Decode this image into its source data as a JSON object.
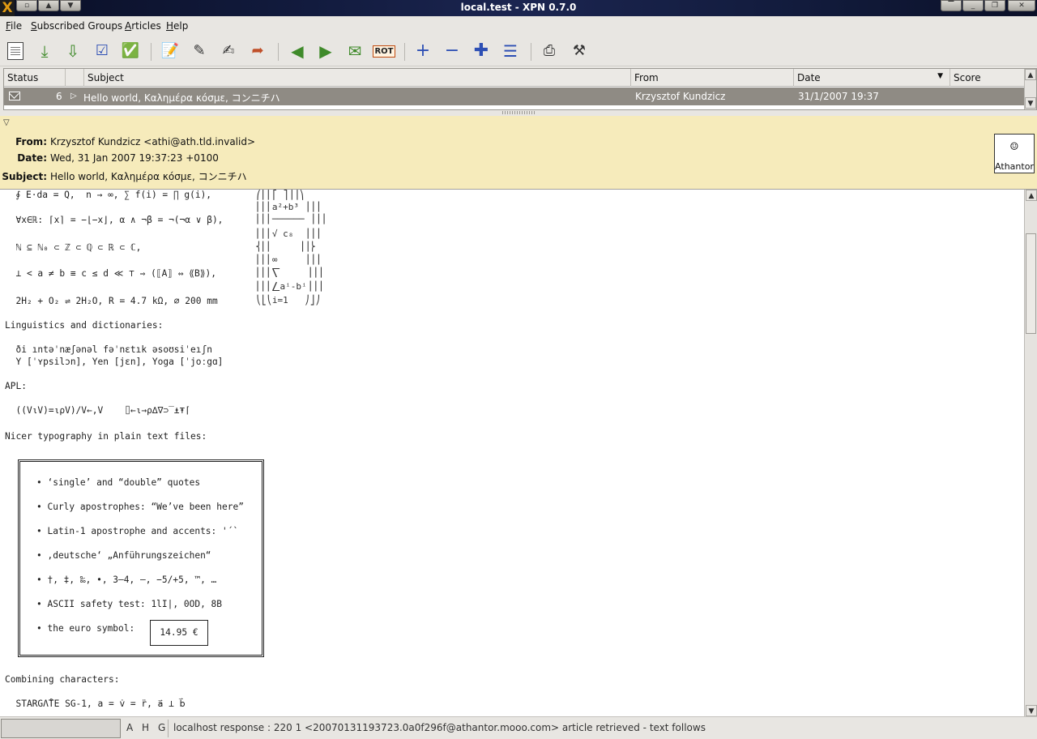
{
  "window": {
    "title": "local.test - XPN 0.7.0",
    "logo_glyph": "X"
  },
  "menu": {
    "items": [
      "File",
      "Subscribed Groups",
      "Articles",
      "Help"
    ]
  },
  "toolbar": {
    "icons": [
      "subscribe-icon",
      "download-headers-icon",
      "download-articles-icon",
      "mark-read-icon",
      "mark-all-read-icon",
      "compose-icon",
      "reply-icon",
      "reply-mail-icon",
      "forward-icon",
      "prev-article-icon",
      "next-article-icon",
      "next-unread-icon",
      "rot13-icon",
      "expand-thread-icon",
      "collapse-thread-icon",
      "expand-all-icon",
      "collapse-all-icon",
      "plugin-icon",
      "settings-icon"
    ],
    "rot_label": "ROT"
  },
  "article_list": {
    "columns": [
      "Status",
      "Subject",
      "From",
      "Date",
      "Score"
    ],
    "sort_column": "Date",
    "rows": [
      {
        "count": "6",
        "subject": "Hello world, Καλημέρα κόσμε, コンニチハ",
        "from": "Krzysztof Kundzicz",
        "date": "31/1/2007 19:37"
      }
    ]
  },
  "headers": {
    "from_label": "From:",
    "from_value": "Krzysztof Kundzicz <athi@ath.tld.invalid>",
    "date_label": "Date:",
    "date_value": "Wed, 31 Jan 2007 19:37:23 +0100",
    "subject_label": "Subject:",
    "subject_value": "Hello world, Καλημέρα κόσμε, コンニチハ",
    "avatar_name": "Athantor"
  },
  "body": {
    "math_lines": [
      "  ∮ E⋅da = Q,  n → ∞, ∑ f(i) = ∏ g(i),",
      "  ∀x∈ℝ: ⌈x⌉ = −⌊−x⌋, α ∧ ¬β = ¬(¬α ∨ β),",
      "  ℕ ⊆ ℕ₀ ⊂ ℤ ⊂ ℚ ⊂ ℝ ⊂ ℂ,",
      "  ⊥ < a ≠ b ≡ c ≤ d ≪ ⊤ ⇒ (⟦A⟧ ⇔ ⟪B⟫),",
      "  2H₂ + O₂ ⇌ 2H₂O, R = 4.7 kΩ, ⌀ 200 mm"
    ],
    "formula_lines": [
      "⎛⎜⎜⎡ ⎤⎟⎟⎞",
      "⎜⎜⎜a²+b³ ⎟⎟⎟",
      "⎜⎜⎜────── ⎟⎟⎟",
      "⎜⎜⎜√ c₈  ⎟⎟⎟",
      "⎨⎜⎜     ⎟⎟⎬",
      "⎜⎜⎜∞     ⎟⎟⎟",
      "⎜⎜⎜⎲     ⎟⎟⎟",
      "⎜⎜⎜⎳aⁱ-bⁱ⎟⎟⎟",
      "⎝⎣⎝i=1   ⎠⎦⎠"
    ],
    "ling_heading": "Linguistics and dictionaries:",
    "ling_lines": [
      "  ði ıntəˈnæʃənəl fəˈnɛtık əsoʊsiˈeıʃn",
      "  Y [ˈʏpsilɔn], Yen [jɛn], Yoga [ˈjoːgɑ]"
    ],
    "apl_heading": "APL:",
    "apl_line": "  ((V⍳V)=⍳⍴V)/V←,V    ⌷←⍳→⍴∆∇⊃‾⍎⍕⌈",
    "typo_heading": "Nicer typography in plain text files:",
    "typo_bullets": [
      "• ‘single’ and “double” quotes",
      "• Curly apostrophes: “We’ve been here”",
      "• Latin-1 apostrophe and accents: '´`",
      "• ‚deutsche‘ „Anführungszeichen“",
      "• †, ‡, ‰, •, 3–4, —, −5/+5, ™, …",
      "• ASCII safety test: 1lI|, 0OD, 8B",
      "• the euro symbol:"
    ],
    "euro_value": "14.95 €",
    "comb_heading": "Combining characters:",
    "comb_line": "  STARGΛ̊TE SG-1, a = v̇ = r̈, a⃑ ⊥ b⃑"
  },
  "statusbar": {
    "flags": [
      "A",
      "H",
      "G"
    ],
    "message": "localhost response : 220 1 <20070131193723.0a0f296f@athantor.mooo.com> article retrieved - text follows"
  }
}
